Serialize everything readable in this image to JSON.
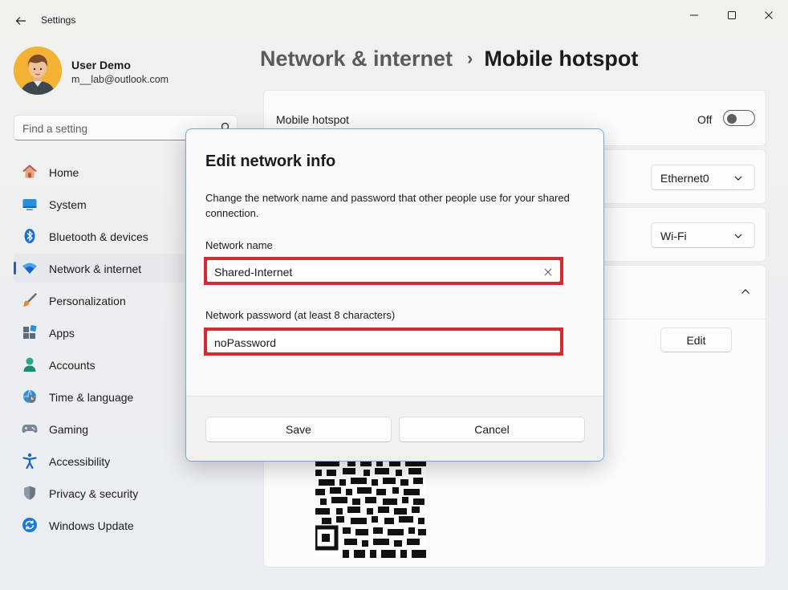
{
  "window": {
    "title": "Settings"
  },
  "profile": {
    "name": "User Demo",
    "email": "m__lab@outlook.com"
  },
  "search": {
    "placeholder": "Find a setting",
    "value": ""
  },
  "sidebar": {
    "items": [
      {
        "label": "Home",
        "icon": "home-icon",
        "active": false
      },
      {
        "label": "System",
        "icon": "system-icon",
        "active": false
      },
      {
        "label": "Bluetooth & devices",
        "icon": "bluetooth-icon",
        "active": false
      },
      {
        "label": "Network & internet",
        "icon": "wifi-icon",
        "active": true
      },
      {
        "label": "Personalization",
        "icon": "brush-icon",
        "active": false
      },
      {
        "label": "Apps",
        "icon": "apps-icon",
        "active": false
      },
      {
        "label": "Accounts",
        "icon": "account-icon",
        "active": false
      },
      {
        "label": "Time & language",
        "icon": "clock-globe-icon",
        "active": false
      },
      {
        "label": "Gaming",
        "icon": "gamepad-icon",
        "active": false
      },
      {
        "label": "Accessibility",
        "icon": "accessibility-icon",
        "active": false
      },
      {
        "label": "Privacy & security",
        "icon": "shield-icon",
        "active": false
      },
      {
        "label": "Windows Update",
        "icon": "update-icon",
        "active": false
      }
    ]
  },
  "breadcrumb": {
    "parent": "Network & internet",
    "separator": "›",
    "current": "Mobile hotspot"
  },
  "main": {
    "hotspot": {
      "label": "Mobile hotspot",
      "state": "Off"
    },
    "share_from": {
      "value": "Ethernet0"
    },
    "share_over": {
      "value": "Wi-Fi"
    },
    "properties": {
      "edit_label": "Edit"
    }
  },
  "dialog": {
    "title": "Edit network info",
    "description": "Change the network name and password that other people use for your shared connection.",
    "name_label": "Network name",
    "name_value": "Shared-Internet",
    "password_label": "Network password (at least 8 characters)",
    "password_value": "noPassword",
    "save_label": "Save",
    "cancel_label": "Cancel"
  },
  "colors": {
    "accent": "#1a62c7",
    "highlight_border": "#d12c34",
    "dialog_border": "#7ea3cc"
  }
}
